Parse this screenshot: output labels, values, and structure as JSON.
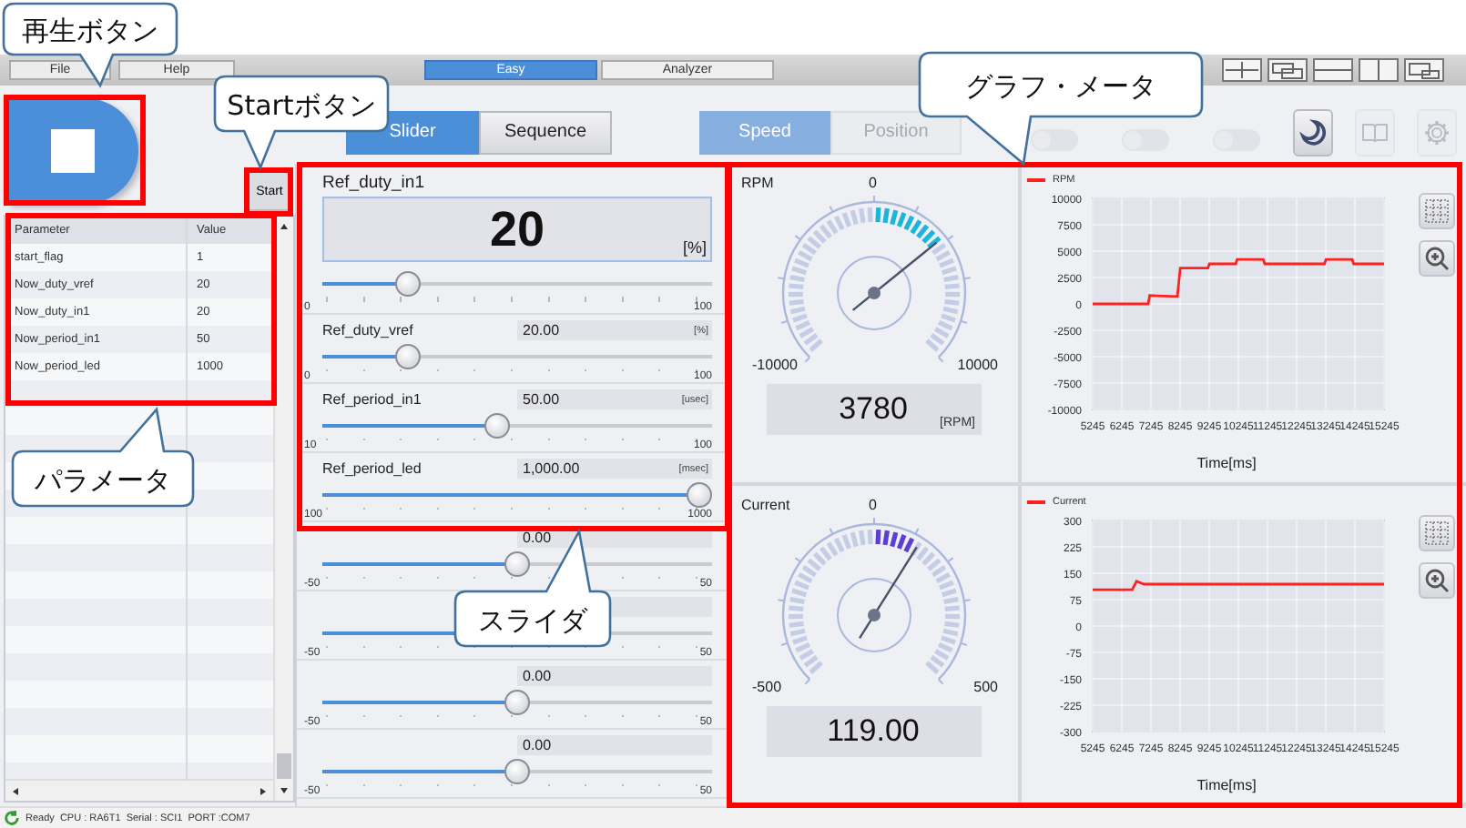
{
  "menu": {
    "items": [
      {
        "label": "File"
      },
      {
        "label": "Help"
      }
    ],
    "modes": [
      {
        "label": "Easy",
        "selected": true
      },
      {
        "label": "Analyzer",
        "selected": false
      }
    ]
  },
  "start_button": "Start",
  "parameters": {
    "columns": [
      "Parameter",
      "Value"
    ],
    "rows": [
      [
        "start_flag",
        "1"
      ],
      [
        "Now_duty_vref",
        "20"
      ],
      [
        "Now_duty_in1",
        "20"
      ],
      [
        "Now_period_in1",
        "50"
      ],
      [
        "Now_period_led",
        "1000"
      ]
    ]
  },
  "toolbar": {
    "view_tabs": [
      {
        "label": "Slider",
        "selected": true
      },
      {
        "label": "Sequence",
        "selected": false
      }
    ],
    "control_tabs": [
      {
        "label": "Speed",
        "selected": true,
        "disabled": true
      },
      {
        "label": "Position",
        "selected": false,
        "disabled": true
      }
    ],
    "toggles": [
      {
        "on": false
      },
      {
        "on": false
      },
      {
        "on": false
      }
    ],
    "buttons": [
      {
        "kind": "theme",
        "disabled": false
      },
      {
        "kind": "manual",
        "disabled": true
      },
      {
        "kind": "settings",
        "disabled": true
      }
    ]
  },
  "sliders": [
    {
      "kind": "big",
      "name": "Ref_duty_in1",
      "value": "20",
      "unit": "[%]",
      "min": "0",
      "max": "100",
      "level": 0.2
    },
    {
      "kind": "normal",
      "name": "Ref_duty_vref",
      "value": "20.00",
      "unit": "[%]",
      "min": "0",
      "max": "100",
      "level": 0.2
    },
    {
      "kind": "normal",
      "name": "Ref_period_in1",
      "value": "50.00",
      "unit": "[usec]",
      "min": "10",
      "max": "100",
      "level": 0.444
    },
    {
      "kind": "normal",
      "name": "Ref_period_led",
      "value": "1,000.00",
      "unit": "[msec]",
      "min": "100",
      "max": "1000",
      "level": 1
    },
    {
      "kind": "normal",
      "value": "0.00",
      "min": "-50",
      "max": "50",
      "level": 0.5
    },
    {
      "kind": "normal",
      "min": "-50",
      "max": "50",
      "level": 0.5
    },
    {
      "kind": "normal",
      "value": "0.00",
      "min": "-50",
      "max": "50",
      "level": 0.5
    },
    {
      "kind": "normal",
      "value": "0.00",
      "min": "-50",
      "max": "50",
      "level": 0.5
    }
  ],
  "meters": [
    {
      "name": "RPM",
      "zero": "0",
      "min": "-10000",
      "max": "10000",
      "value": "3780",
      "unit": "[RPM]",
      "level": 0.689,
      "color": "#1fb3d8",
      "chart_data": {
        "type": "line",
        "xlabel": "Time[ms]",
        "xlim": [
          5245,
          15245
        ],
        "ylim": [
          -10000,
          10000
        ],
        "xticks": [
          5245,
          6245,
          7245,
          8245,
          9245,
          10245,
          11245,
          12245,
          13245,
          14245,
          15245
        ],
        "yticks": [
          -10000,
          -7500,
          -5000,
          -2500,
          0,
          2500,
          5000,
          7500,
          10000
        ],
        "x": [
          5245,
          7150,
          7200,
          8150,
          8250,
          9200,
          9250,
          10150,
          10200,
          11100,
          11150,
          13200,
          13250,
          14150,
          14200,
          15245
        ],
        "grid": true,
        "series": [
          {
            "name": "RPM",
            "color": "#ff2020",
            "values": [
              0,
              0,
              800,
              700,
              3400,
              3400,
              3800,
              3800,
              4200,
              4200,
              3800,
              3800,
              4200,
              4200,
              3800,
              3800
            ]
          }
        ]
      }
    },
    {
      "name": "Current",
      "zero": "0",
      "min": "-500",
      "max": "500",
      "value": "119.00",
      "level": 0.619,
      "color": "#5a3fd0",
      "chart_data": {
        "type": "line",
        "xlabel": "Time[ms]",
        "xlim": [
          5245,
          15245
        ],
        "ylim": [
          -300,
          300
        ],
        "xticks": [
          5245,
          6245,
          7245,
          8245,
          9245,
          10245,
          11245,
          12245,
          13245,
          14245,
          15245
        ],
        "yticks": [
          -300,
          -225,
          -150,
          -75,
          0,
          75,
          150,
          225,
          300
        ],
        "x": [
          5245,
          6600,
          6750,
          7000,
          15245
        ],
        "grid": true,
        "series": [
          {
            "name": "Current",
            "color": "#ff2020",
            "values": [
              103,
              103,
              127,
              119,
              119
            ]
          }
        ]
      }
    }
  ],
  "status_bar": "Ready  CPU : RA6T1  Serial : SCI1  PORT :COM7",
  "annotations": [
    {
      "text": "再生ボタン"
    },
    {
      "text": "Startボタン"
    },
    {
      "text": "グラフ・メータ"
    },
    {
      "text": "パラメータ"
    },
    {
      "text": "スライダ"
    }
  ]
}
